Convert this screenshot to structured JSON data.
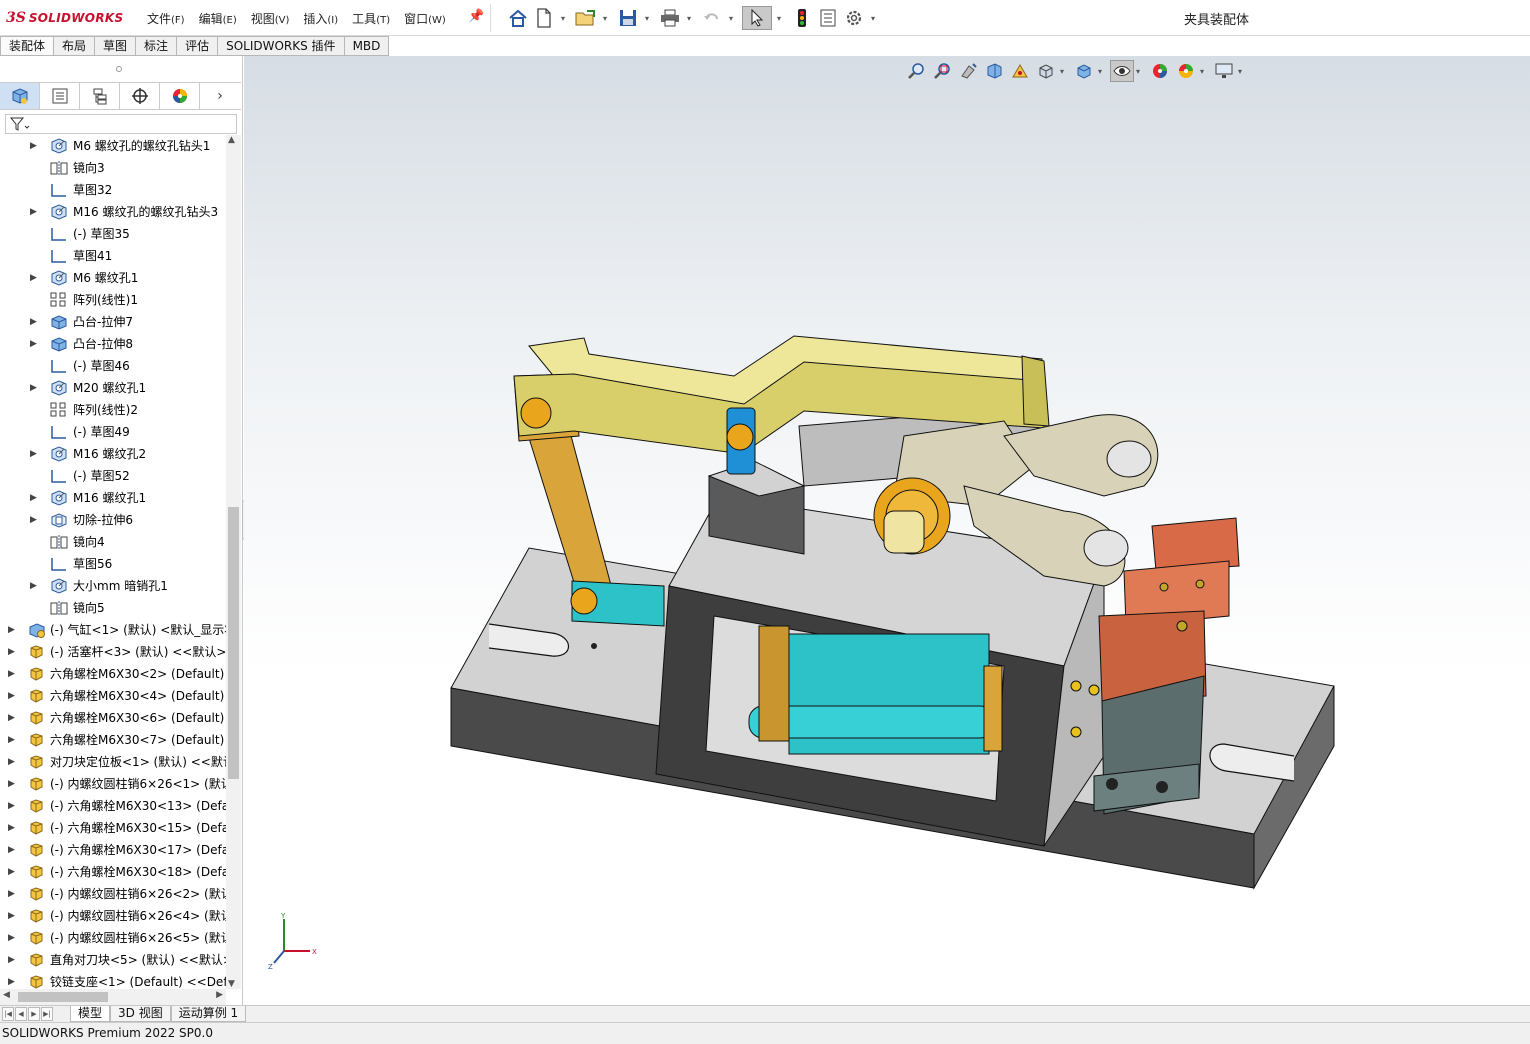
{
  "app": {
    "logo_prefix": "3S",
    "logo_text": "SOLIDWORKS",
    "document_title": "夹具装配体"
  },
  "menu": [
    {
      "label": "文件",
      "accel": "(F)"
    },
    {
      "label": "编辑",
      "accel": "(E)"
    },
    {
      "label": "视图",
      "accel": "(V)"
    },
    {
      "label": "插入",
      "accel": "(I)"
    },
    {
      "label": "工具",
      "accel": "(T)"
    },
    {
      "label": "窗口",
      "accel": "(W)"
    }
  ],
  "toolbar_icons": [
    "home-icon",
    "new-document-icon",
    "open-folder-icon",
    "save-icon",
    "print-icon",
    "undo-icon",
    "select-pointer-icon",
    "rebuild-traffic-light-icon",
    "file-properties-icon",
    "options-gear-icon"
  ],
  "command_tabs": [
    "装配体",
    "布局",
    "草图",
    "标注",
    "评估",
    "SOLIDWORKS 插件",
    "MBD"
  ],
  "panel_tabs": [
    "featuremanager-tab",
    "propertymanager-tab",
    "configurationmanager-tab",
    "dimxpert-tab",
    "display-manager-tab"
  ],
  "panel_more": "›",
  "tree": [
    {
      "label": "M6 螺纹孔的螺纹孔钻头1",
      "level": 1,
      "expandable": true,
      "icon": "hole-wizard"
    },
    {
      "label": "镜向3",
      "level": 1,
      "expandable": false,
      "icon": "mirror"
    },
    {
      "label": "草图32",
      "level": 1,
      "expandable": false,
      "icon": "sketch"
    },
    {
      "label": "M16 螺纹孔的螺纹孔钻头3",
      "level": 1,
      "expandable": true,
      "icon": "hole-wizard"
    },
    {
      "label": "(-) 草图35",
      "level": 1,
      "expandable": false,
      "icon": "sketch"
    },
    {
      "label": "草图41",
      "level": 1,
      "expandable": false,
      "icon": "sketch"
    },
    {
      "label": "M6 螺纹孔1",
      "level": 1,
      "expandable": true,
      "icon": "hole-wizard"
    },
    {
      "label": "阵列(线性)1",
      "level": 1,
      "expandable": false,
      "icon": "linear-pattern"
    },
    {
      "label": "凸台-拉伸7",
      "level": 1,
      "expandable": true,
      "icon": "boss-extrude"
    },
    {
      "label": "凸台-拉伸8",
      "level": 1,
      "expandable": true,
      "icon": "boss-extrude"
    },
    {
      "label": "(-) 草图46",
      "level": 1,
      "expandable": false,
      "icon": "sketch"
    },
    {
      "label": "M20 螺纹孔1",
      "level": 1,
      "expandable": true,
      "icon": "hole-wizard"
    },
    {
      "label": "阵列(线性)2",
      "level": 1,
      "expandable": false,
      "icon": "linear-pattern"
    },
    {
      "label": "(-) 草图49",
      "level": 1,
      "expandable": false,
      "icon": "sketch"
    },
    {
      "label": "M16 螺纹孔2",
      "level": 1,
      "expandable": true,
      "icon": "hole-wizard"
    },
    {
      "label": "(-) 草图52",
      "level": 1,
      "expandable": false,
      "icon": "sketch"
    },
    {
      "label": "M16 螺纹孔1",
      "level": 1,
      "expandable": true,
      "icon": "hole-wizard"
    },
    {
      "label": "切除-拉伸6",
      "level": 1,
      "expandable": true,
      "icon": "cut-extrude"
    },
    {
      "label": "镜向4",
      "level": 1,
      "expandable": false,
      "icon": "mirror"
    },
    {
      "label": "草图56",
      "level": 1,
      "expandable": false,
      "icon": "sketch"
    },
    {
      "label": "大小mm 暗销孔1",
      "level": 1,
      "expandable": true,
      "icon": "hole-wizard"
    },
    {
      "label": "镜向5",
      "level": 1,
      "expandable": false,
      "icon": "mirror"
    },
    {
      "label": "(-) 气缸<1> (默认) <默认_显示状",
      "level": 0,
      "expandable": true,
      "icon": "subassembly"
    },
    {
      "label": "(-) 活塞杆<3> (默认) <<默认>_",
      "level": 0,
      "expandable": true,
      "icon": "part"
    },
    {
      "label": "六角螺栓M6X30<2> (Default) -",
      "level": 0,
      "expandable": true,
      "icon": "part"
    },
    {
      "label": "六角螺栓M6X30<4> (Default) -",
      "level": 0,
      "expandable": true,
      "icon": "part"
    },
    {
      "label": "六角螺栓M6X30<6> (Default) -",
      "level": 0,
      "expandable": true,
      "icon": "part"
    },
    {
      "label": "六角螺栓M6X30<7> (Default) -",
      "level": 0,
      "expandable": true,
      "icon": "part"
    },
    {
      "label": "对刀块定位板<1> (默认) <<默认",
      "level": 0,
      "expandable": true,
      "icon": "part"
    },
    {
      "label": "(-) 内螺纹圆柱销6×26<1> (默认",
      "level": 0,
      "expandable": true,
      "icon": "part"
    },
    {
      "label": "(-) 六角螺栓M6X30<13> (Defa",
      "level": 0,
      "expandable": true,
      "icon": "part"
    },
    {
      "label": "(-) 六角螺栓M6X30<15> (Defa",
      "level": 0,
      "expandable": true,
      "icon": "part"
    },
    {
      "label": "(-) 六角螺栓M6X30<17> (Defa",
      "level": 0,
      "expandable": true,
      "icon": "part"
    },
    {
      "label": "(-) 六角螺栓M6X30<18> (Defa",
      "level": 0,
      "expandable": true,
      "icon": "part"
    },
    {
      "label": "(-) 内螺纹圆柱销6×26<2> (默认",
      "level": 0,
      "expandable": true,
      "icon": "part"
    },
    {
      "label": "(-) 内螺纹圆柱销6×26<4> (默认",
      "level": 0,
      "expandable": true,
      "icon": "part"
    },
    {
      "label": "(-) 内螺纹圆柱销6×26<5> (默认",
      "level": 0,
      "expandable": true,
      "icon": "part"
    },
    {
      "label": "直角对刀块<5> (默认) <<默认>",
      "level": 0,
      "expandable": true,
      "icon": "part"
    },
    {
      "label": "铰链支座<1> (Default) <<Defa",
      "level": 0,
      "expandable": true,
      "icon": "part"
    }
  ],
  "bottom_tabs": [
    "模型",
    "3D 视图",
    "运动算例 1"
  ],
  "status": "SOLIDWORKS Premium 2022 SP0.0",
  "triad_labels": {
    "y": "Y",
    "x": "X",
    "z": "Z"
  },
  "colors": {
    "brand_red": "#c8102e",
    "base_gray": "#cfcfcf",
    "lever_yellow": "#e8e08a",
    "link_orange": "#d9a43a",
    "cylinder_cyan": "#2cc2c8",
    "clamp_beige": "#d8d3b8",
    "block_copper": "#c8623f"
  }
}
